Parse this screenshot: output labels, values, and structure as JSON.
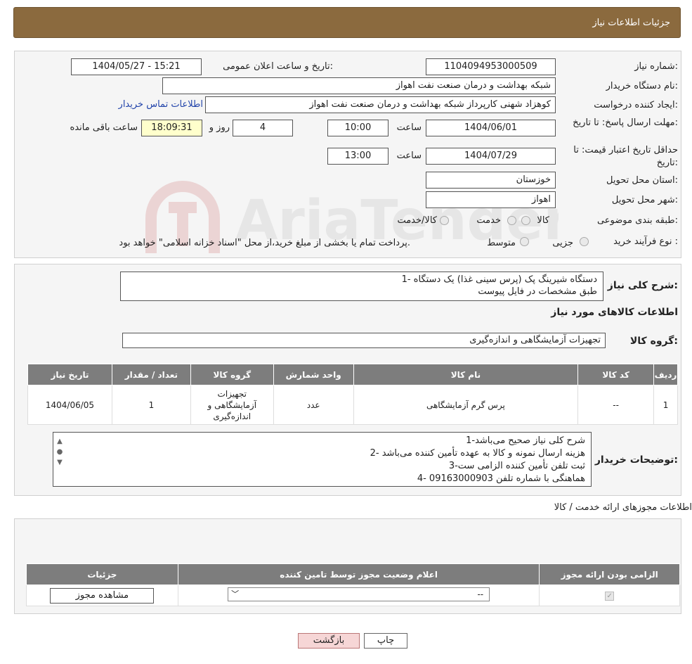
{
  "header": {
    "title": "جزئیات اطلاعات نیاز"
  },
  "form": {
    "need_number_label": "شماره نیاز:",
    "need_number": "1104094953000509",
    "announce_label": "تاریخ و ساعت اعلان عمومی:",
    "announce_value": "1404/05/27 - 15:21",
    "buyer_org_label": "نام دستگاه خریدار:",
    "buyer_org": "شبکه بهداشت و درمان صنعت نفت اهواز",
    "requester_label": "ایجاد کننده درخواست:",
    "requester": "کوهزاد شهنی کارپرداز شبکه بهداشت و درمان صنعت نفت اهواز",
    "contact_link": "اطلاعات تماس خریدار",
    "deadline_label": "مهلت ارسال پاسخ: تا تاریخ:",
    "deadline_date": "1404/06/01",
    "time_label": "ساعت",
    "deadline_time": "10:00",
    "days_value": "4",
    "days_label": "روز و",
    "remaining_time": "18:09:31",
    "remaining_label": "ساعت باقی مانده",
    "validity_label": "حداقل تاریخ اعتبار قیمت: تا تاریخ:",
    "validity_date": "1404/07/29",
    "validity_time": "13:00",
    "province_label": "استان محل تحویل:",
    "province": "خوزستان",
    "city_label": "شهر محل تحویل:",
    "city": "اهواز",
    "category_label": "طبقه بندی موضوعی:",
    "category_options": [
      "کالا",
      "خدمت",
      "کالا/خدمت"
    ],
    "purchase_type_label": "نوع فرآیند خرید :",
    "purchase_type_options": [
      "جزیی",
      "متوسط"
    ],
    "purchase_note": "پرداخت تمام یا بخشی از مبلغ خرید،از محل \"اسناد خزانه اسلامی\" خواهد بود."
  },
  "description": {
    "label": "شرح کلی نیاز:",
    "lines": [
      "1- دستگاه شیرینگ پک (پرس سینی غذا) یک دستگاه",
      "طبق مشخصات در فایل پیوست"
    ]
  },
  "goods": {
    "section_title": "اطلاعات کالاهای مورد نیاز",
    "group_label": "گروه کالا:",
    "group_value": "تجهیزات آزمایشگاهی و اندازه‌گیری",
    "columns": [
      "ردیف",
      "کد کالا",
      "نام کالا",
      "واحد شمارش",
      "گروه کالا",
      "تعداد / مقدار",
      "تاریخ نیاز"
    ],
    "rows": [
      {
        "row": "1",
        "code": "--",
        "name": "پرس گرم آزمایشگاهی",
        "unit": "عدد",
        "group": "تجهیزات آزمایشگاهی و اندازه‌گیری",
        "qty": "1",
        "date": "1404/06/05"
      }
    ]
  },
  "buyer_notes": {
    "label": "توضیحات خریدار:",
    "lines": [
      "1-شرح کلی نیاز صحیح می‌باشد",
      "2- هزینه ارسال نمونه و کالا به عهده تأمین کننده می‌باشد",
      "3-ثبت تلفن تأمین کننده الزامی ست",
      "4- هماهنگی با شماره تلفن 09163000903"
    ]
  },
  "licenses": {
    "section_title": "اطلاعات مجوزهای ارائه خدمت / کالا",
    "columns": [
      "الزامی بودن ارائه مجوز",
      "اعلام وضعیت مجوز توسط تامین کننده",
      "جزئیات"
    ],
    "select_value": "--",
    "view_button": "مشاهده مجوز"
  },
  "buttons": {
    "print": "چاپ",
    "back": "بازگشت"
  },
  "watermark": "AriaTender.neT"
}
